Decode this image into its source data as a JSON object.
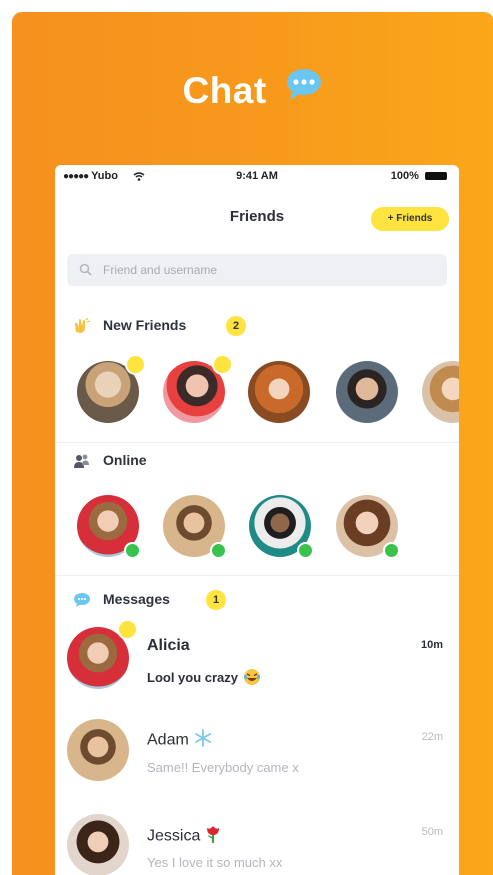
{
  "hero": {
    "title": "Chat",
    "icon": "speech-bubble-icon"
  },
  "status_bar": {
    "carrier": "Yubo",
    "time": "9:41 AM",
    "battery": "100%"
  },
  "nav": {
    "title": "Friends",
    "add_button": "+ Friends"
  },
  "search": {
    "placeholder": "Friend and username"
  },
  "sections": {
    "new_friends": {
      "label": "New Friends",
      "count": "2",
      "icon": "waving-hands-icon"
    },
    "online": {
      "label": "Online",
      "icon": "people-silhouette-icon"
    },
    "messages": {
      "label": "Messages",
      "count": "1",
      "icon": "speech-bubble-icon"
    }
  },
  "new_friends": [
    {
      "avatar": "avatar-blonde-woman",
      "new": true
    },
    {
      "avatar": "avatar-woman-watermelon",
      "new": true
    },
    {
      "avatar": "avatar-curly-redhead",
      "new": false
    },
    {
      "avatar": "avatar-young-man",
      "new": false
    },
    {
      "avatar": "avatar-laughing-woman",
      "new": false
    }
  ],
  "online": [
    {
      "avatar": "avatar-woman-red-top",
      "online": true
    },
    {
      "avatar": "avatar-man-field",
      "online": true
    },
    {
      "avatar": "avatar-man-cap",
      "online": true
    },
    {
      "avatar": "avatar-curly-woman",
      "online": true
    }
  ],
  "messages": [
    {
      "name": "Alicia",
      "preview": "Lool you crazy",
      "time": "10m",
      "unread": true,
      "emoji": "laughing-face-icon"
    },
    {
      "name": "Adam",
      "preview": "Same!! Everybody came x",
      "time": "22m",
      "unread": false,
      "emoji": "snowflake-icon"
    },
    {
      "name": "Jessica",
      "preview": "Yes I love it so much xx",
      "time": "50m",
      "unread": false,
      "emoji": "rose-icon"
    }
  ],
  "colors": {
    "background": "#f7951e",
    "accent": "#ffe33f",
    "online": "#3ac24f",
    "text": "#2c2f38"
  }
}
